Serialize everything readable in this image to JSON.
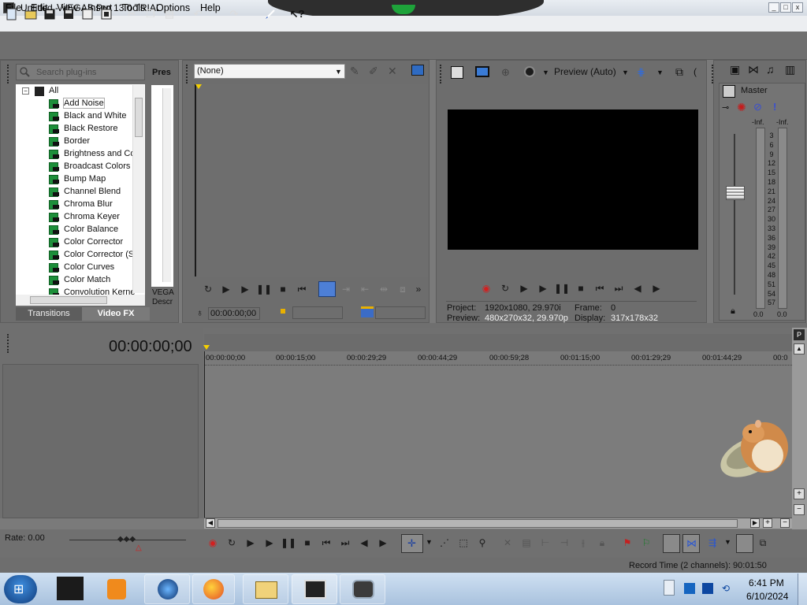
{
  "window": {
    "title": "Untitled - VEGAS Pro 13.0 TRIAL",
    "minimize": "_",
    "maximize": "□",
    "close": "x"
  },
  "menu": [
    "File",
    "Edit",
    "View",
    "Insert",
    "Tools",
    "Options",
    "Help"
  ],
  "toolbar_icons": [
    "new-icon",
    "open-icon",
    "save-icon",
    "save-as-icon",
    "render-icon",
    "cut-icon",
    "copy-icon",
    "paste-icon",
    "undo-icon",
    "redo-icon",
    "edit-tool-icon",
    "whats-this-icon"
  ],
  "plugins": {
    "search_placeholder": "Search plug-ins",
    "root": "All",
    "items": [
      "Add Noise",
      "Black and White",
      "Black Restore",
      "Border",
      "Brightness and Co",
      "Broadcast Colors",
      "Bump Map",
      "Channel Blend",
      "Chroma Blur",
      "Chroma Keyer",
      "Color Balance",
      "Color Corrector",
      "Color Corrector (S",
      "Color Curves",
      "Color Match",
      "Convolution Kerne"
    ],
    "selected": "Add Noise",
    "tabs": [
      "Transitions",
      "Video FX"
    ],
    "active_tab": "Video FX",
    "presets_header": "Pres",
    "description_line1": "VEGA",
    "description_line2": "Descr"
  },
  "trimmer": {
    "dropdown": "(None)",
    "timecode": "00:00:00;00"
  },
  "preview": {
    "mode": "Preview (Auto)",
    "project_label": "Project:",
    "project_value": "1920x1080, 29.970i",
    "frame_label": "Frame:",
    "frame_value": "0",
    "preview_label": "Preview:",
    "preview_value": "480x270x32, 29.970p",
    "display_label": "Display:",
    "display_value": "317x178x32"
  },
  "mixer": {
    "master": "Master",
    "peak_left": "-Inf.",
    "peak_right": "-Inf.",
    "scale": [
      "3",
      "6",
      "9",
      "12",
      "15",
      "18",
      "21",
      "24",
      "27",
      "30",
      "33",
      "36",
      "39",
      "42",
      "45",
      "48",
      "51",
      "54",
      "57"
    ],
    "bottom_left": "0.0",
    "bottom_right": "0.0"
  },
  "timeline": {
    "cursor_time": "00:00:00;00",
    "ruler": [
      "00:00:00;00",
      "00:00:15;00",
      "00:00:29;29",
      "00:00:44;29",
      "00:00:59;28",
      "00:01:15;00",
      "00:01:29;29",
      "00:01:44;29",
      "00:0"
    ],
    "rate": "Rate: 0.00",
    "record_time": "Record Time (2 channels): 90:01:50"
  },
  "taskbar": {
    "time": "6:41 PM",
    "date": "6/10/2024"
  },
  "colors": {
    "accent_green": "#1ea33a",
    "record_red": "#d22020",
    "taskbar": "#b7cde6"
  }
}
